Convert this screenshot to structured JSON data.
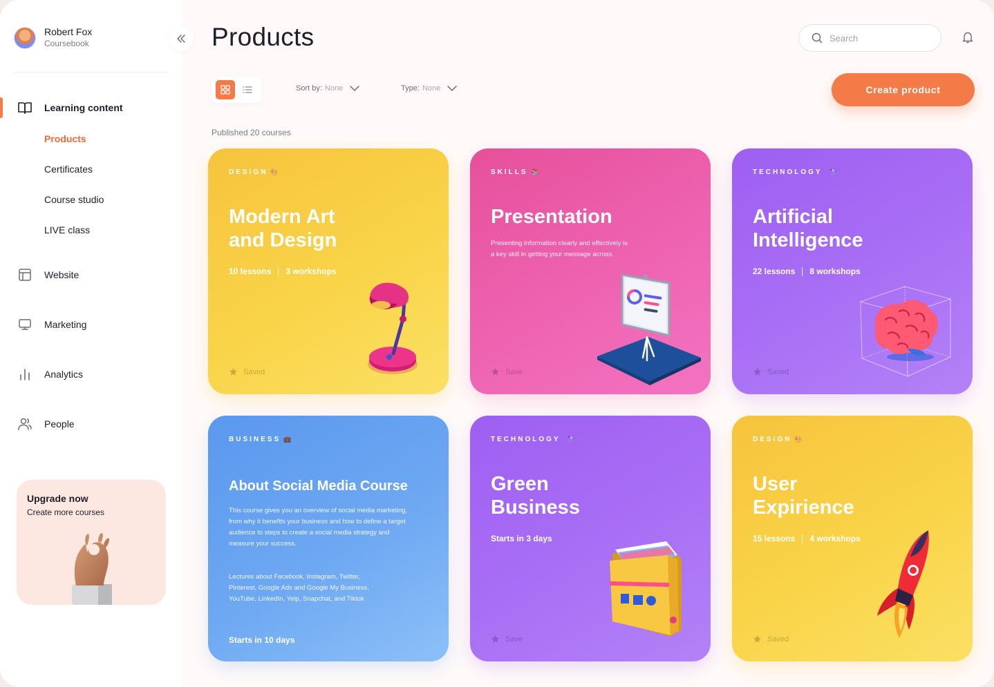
{
  "profile": {
    "name": "Robert Fox",
    "subtitle": "Coursebook"
  },
  "nav": {
    "learning_content": "Learning content",
    "sub_items": [
      "Products",
      "Certificates",
      "Course studio",
      "LIVE class"
    ],
    "website": "Website",
    "marketing": "Marketing",
    "analytics": "Analytics",
    "people": "People"
  },
  "upgrade": {
    "title": "Upgrade now",
    "subtitle": "Create more courses"
  },
  "header": {
    "title": "Products",
    "search_placeholder": "Search"
  },
  "toolbar": {
    "sort_label": "Sort by:",
    "sort_value": "None",
    "type_label": "Type:",
    "type_value": "None",
    "create_button": "Create product"
  },
  "published_text": "Published 20 courses",
  "cards": [
    {
      "tag": "DESIGN",
      "tag_emoji": "🎨",
      "title": "Modern Art and Design",
      "lessons": "10 lessons",
      "workshops": "3 workshops",
      "save": "Saved",
      "color": "#f8cc45"
    },
    {
      "tag": "SKILLS",
      "tag_emoji": "📚",
      "title": "Presentation",
      "description": "Presenting information clearly and effectively is a key skill in getting your message across.",
      "save": "Save",
      "color": "#ec5faa"
    },
    {
      "tag": "TECHNOLOGY",
      "tag_emoji": "🔭",
      "title": "Artificial Intelligence",
      "lessons": "22 lessons",
      "workshops": "8 workshops",
      "save": "Saved",
      "color": "#a86df4"
    },
    {
      "tag": "BUSINESS",
      "tag_emoji": "💼",
      "title": "About Social Media Course",
      "description": "This course gives you an overview of social media marketing, from why it benefits your business and how to define a target audience to steps to create a social media strategy and measure your success.",
      "description2": "Lectures about Facebook, Instagram, Twitter, Pinterest, Google Ads and Google My Business, YouTube, LinkedIn, Yelp, Snapchat, and Tiktok",
      "starts": "Starts in 10 days",
      "color": "#6aa6f2"
    },
    {
      "tag": "TECHNOLOGY",
      "tag_emoji": "🔭",
      "title": "Green Business",
      "starts": "Starts in 3 days",
      "save": "Save",
      "color": "#a86df4"
    },
    {
      "tag": "DESIGN",
      "tag_emoji": "🎨",
      "title": "User Expirience",
      "lessons": "15 lessons",
      "workshops": "4 workshops",
      "save": "Saved",
      "color": "#f8cc45"
    }
  ],
  "icons": [
    "collapse-icon",
    "book-icon",
    "layout-icon",
    "monitor-icon",
    "analytics-icon",
    "people-icon",
    "search-icon",
    "bell-icon",
    "grid-icon",
    "list-icon",
    "chevron-down-icon",
    "star-icon"
  ],
  "accent_color": "#f47a47"
}
